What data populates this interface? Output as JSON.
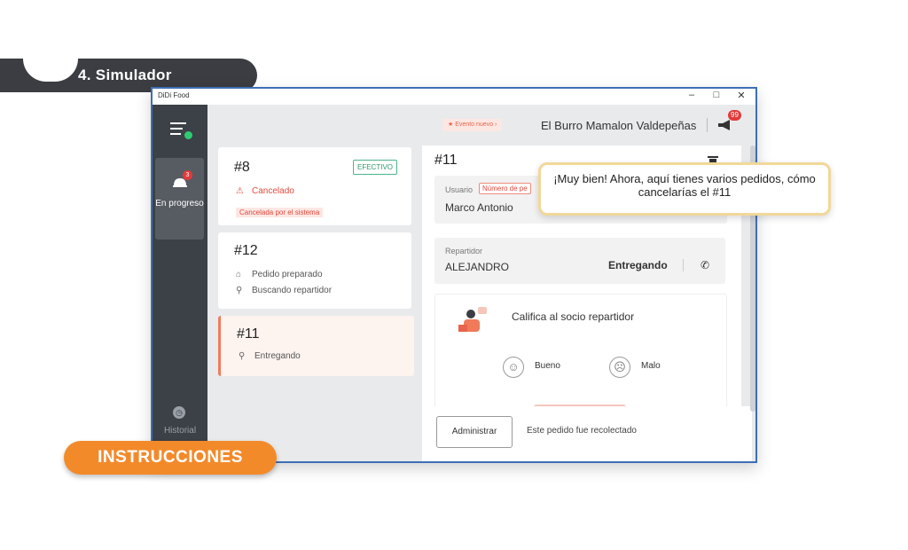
{
  "banner": {
    "title": "4. Simulador"
  },
  "window": {
    "app_name": "DiDi Food",
    "controls": {
      "minimize": "–",
      "maximize": "□",
      "close": "✕"
    }
  },
  "sidebar": {
    "in_progress": {
      "label": "En progreso",
      "badge": "3",
      "icon": "bell-icon"
    },
    "history": {
      "label": "Historial",
      "icon": "clock-icon"
    }
  },
  "header": {
    "event_label": "Evento nuevo",
    "store_name": "El Burro Mamalon Valdepeñas",
    "notif_badge": "99"
  },
  "orders": [
    {
      "number": "#8",
      "payment": "EFECTIVO",
      "status": "Cancelado",
      "note": "Cancelada por el sistema"
    },
    {
      "number": "#12",
      "line1": "Pedido preparado",
      "line2": "Buscando repartidor"
    },
    {
      "number": "#11",
      "line1": "Entregando"
    }
  ],
  "detail": {
    "number": "#11",
    "user_label": "Usuario",
    "order_num_label": "Número de pe",
    "user_name": "Marco Antonio",
    "courier_label": "Repartidor",
    "courier_name": "ALEJANDRO",
    "status": "Entregando",
    "rate_title": "Califica al socio repartidor",
    "good_label": "Bueno",
    "bad_label": "Malo",
    "admin_button": "Administrar",
    "footer_text": "Este pedido fue recolectado"
  },
  "tooltip": {
    "text": "¡Muy bien! Ahora, aquí tienes varios pedidos, cómo cancelarías el #11"
  },
  "instructions": {
    "label": "INSTRUCCIONES"
  },
  "colors": {
    "accent": "#f38a2a",
    "sidebar": "#3c4047",
    "cancel": "#e04a3f",
    "cash": "#2f9a6f"
  }
}
